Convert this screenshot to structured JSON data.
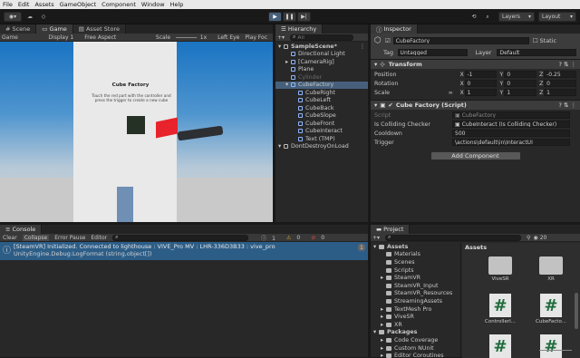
{
  "menu": [
    "File",
    "Edit",
    "Assets",
    "GameObject",
    "Component",
    "Window",
    "Help"
  ],
  "toolbar": {
    "layers": "Layers",
    "layout": "Layout"
  },
  "scene_tabs": [
    "Scene",
    "Game",
    "Asset Store"
  ],
  "game_bar": {
    "display_mode": "Game",
    "display": "Display 1",
    "aspect": "Free Aspect",
    "scale_label": "Scale",
    "scale_value": "1x",
    "eye": "Left Eye",
    "play_focus": "Play Foc"
  },
  "viewport": {
    "panel_title": "Cube Factory",
    "panel_text": "Touch the red part with the controller and press the trigger to create a new cube"
  },
  "hierarchy": {
    "tab": "Hierarchy",
    "search_placeholder": "All",
    "items": [
      {
        "label": "SampleScene*",
        "indent": 0,
        "bold": true
      },
      {
        "label": "Directional Light",
        "indent": 1
      },
      {
        "label": "[CameraRig]",
        "indent": 1
      },
      {
        "label": "Plane",
        "indent": 1
      },
      {
        "label": "Cylinder",
        "indent": 1,
        "dim": true
      },
      {
        "label": "CubeFactory",
        "indent": 1,
        "selected": true
      },
      {
        "label": "CubeRight",
        "indent": 2
      },
      {
        "label": "CubeLeft",
        "indent": 2
      },
      {
        "label": "CubeBack",
        "indent": 2
      },
      {
        "label": "CubeSlope",
        "indent": 2
      },
      {
        "label": "CubeFront",
        "indent": 2
      },
      {
        "label": "CubeInteract",
        "indent": 2
      },
      {
        "label": "Text (TMP)",
        "indent": 2
      },
      {
        "label": "DontDestroyOnLoad",
        "indent": 0
      }
    ]
  },
  "inspector": {
    "tab": "Inspector",
    "object_name": "CubeFactory",
    "static_label": "Static",
    "tag_label": "Tag",
    "tag_value": "Untagged",
    "layer_label": "Layer",
    "layer_value": "Default",
    "transform_title": "Transform",
    "position_label": "Position",
    "position": {
      "x": "-1",
      "y": "0",
      "z": "-0.25"
    },
    "rotation_label": "Rotation",
    "rotation": {
      "x": "0",
      "y": "0",
      "z": "0"
    },
    "scale_label": "Scale",
    "scale": {
      "x": "1",
      "y": "1",
      "z": "1"
    },
    "script_title": "Cube Factory (Script)",
    "script_label": "Script",
    "script_value": "CubeFactory",
    "colliding_label": "Is Colliding Checker",
    "colliding_value": "CubeInteract (Is Colliding Checker)",
    "cooldown_label": "Cooldown",
    "cooldown_value": "500",
    "trigger_label": "Trigger",
    "trigger_value": "\\actions\\default\\in\\InteractUI",
    "add_component": "Add Component"
  },
  "console": {
    "tab": "Console",
    "clear": "Clear",
    "collapse": "Collapse",
    "error_pause": "Error Pause",
    "editor": "Editor",
    "count_info": "1",
    "count_warn": "0",
    "count_err": "0",
    "message_line1": "[SteamVR] Initialized. Connected to lighthouse : VIVE_Pro MV : LHR-336D3B33 : vive_pro",
    "message_line2": "UnityEngine.Debug:LogFormat (string,object[])",
    "message_count": "1"
  },
  "project": {
    "tab": "Project",
    "assets_header": "Assets",
    "zoom_count": "20",
    "tree": [
      {
        "label": "Assets",
        "indent": 0,
        "bold": true
      },
      {
        "label": "Materials",
        "indent": 1
      },
      {
        "label": "Scenes",
        "indent": 1
      },
      {
        "label": "Scripts",
        "indent": 1
      },
      {
        "label": "SteamVR",
        "indent": 1
      },
      {
        "label": "SteamVR_Input",
        "indent": 1
      },
      {
        "label": "SteamVR_Resources",
        "indent": 1
      },
      {
        "label": "StreamingAssets",
        "indent": 1
      },
      {
        "label": "TextMesh Pro",
        "indent": 1
      },
      {
        "label": "ViveSR",
        "indent": 1
      },
      {
        "label": "XR",
        "indent": 1
      },
      {
        "label": "Packages",
        "indent": 0,
        "bold": true
      },
      {
        "label": "Code Coverage",
        "indent": 1
      },
      {
        "label": "Custom NUnit",
        "indent": 1
      },
      {
        "label": "Editor Coroutines",
        "indent": 1
      }
    ],
    "grid": [
      {
        "label": "ViveSR",
        "kind": "folder"
      },
      {
        "label": "XR",
        "kind": "folder"
      },
      {
        "label": "ControllerI...",
        "kind": "script"
      },
      {
        "label": "CubeFacto...",
        "kind": "script"
      },
      {
        "label": "",
        "kind": "script"
      },
      {
        "label": "",
        "kind": "script"
      }
    ]
  }
}
